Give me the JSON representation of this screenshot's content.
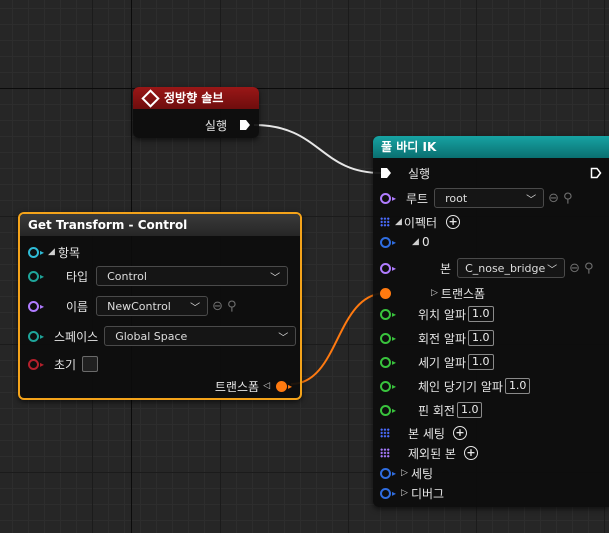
{
  "solve_node": {
    "title": "정방향 솔브",
    "exec_out_label": "실행",
    "header_color": "#8b1111"
  },
  "transform_node": {
    "title": "Get Transform - Control",
    "header_color": "#2d2d2d",
    "border_color": "#f4a31a",
    "item_group": "항목",
    "type_label": "타입",
    "type_value": "Control",
    "name_label": "이름",
    "name_value": "NewControl",
    "space_label": "스페이스",
    "space_value": "Global Space",
    "initial_label": "초기",
    "output_label": "트랜스폼"
  },
  "fullbody_node": {
    "title": "풀 바디 IK",
    "header_color": "#0c8c8c",
    "exec_label": "실행",
    "root_label": "루트",
    "root_value": "root",
    "effector_label": "이펙터",
    "index_label": "0",
    "bone_label": "본",
    "bone_value": "C_nose_bridge",
    "transform_label": "트랜스폼",
    "pos_alpha_label": "위치 알파",
    "pos_alpha_value": "1.0",
    "rot_alpha_label": "회전 알파",
    "rot_alpha_value": "1.0",
    "strength_alpha_label": "세기 알파",
    "strength_alpha_value": "1.0",
    "chain_pull_label": "체인 당기기 알파",
    "chain_pull_value": "1.0",
    "pin_rot_label": "핀 회전",
    "pin_rot_value": "1.0",
    "bone_settings_label": "본 세팅",
    "excluded_bones_label": "제외된 본",
    "settings_label": "세팅",
    "debug_label": "디버그"
  },
  "icons": [
    "exec-pin",
    "dropdown-chevron",
    "use-selected-icon",
    "browse-icon",
    "add-icon",
    "array-grid-icon",
    "expand-triangle"
  ],
  "colors": {
    "exec_wire": "#e6e6e6",
    "transform_wire": "#ff7a10",
    "vector_pin": "#2fbbd6",
    "name_pin": "#b07cff",
    "float_pin": "#39c33d",
    "bool_pin": "#b4202c",
    "struct_pin": "#2f6de0"
  }
}
